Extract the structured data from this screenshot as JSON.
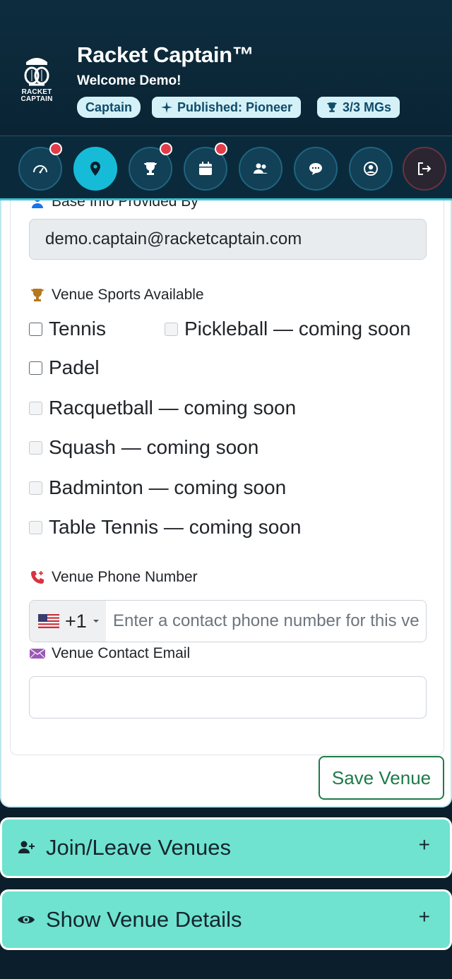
{
  "header": {
    "logo_text": "RACKET CAPTAIN",
    "app_title": "Racket Captain™",
    "welcome": "Welcome Demo!",
    "badges": [
      {
        "label": "Captain"
      },
      {
        "label": "Published: Pioneer"
      },
      {
        "label": "3/3 MGs"
      }
    ]
  },
  "nav": {
    "items": [
      {
        "icon": "dashboard-icon",
        "notification": true
      },
      {
        "icon": "location-pin-icon",
        "active": true,
        "notification": false
      },
      {
        "icon": "trophy-icon",
        "notification": true
      },
      {
        "icon": "calendar-icon",
        "notification": true
      },
      {
        "icon": "users-icon",
        "notification": false
      },
      {
        "icon": "chat-icon",
        "notification": false
      },
      {
        "icon": "user-circle-icon",
        "notification": false
      },
      {
        "icon": "logout-icon",
        "notification": false
      }
    ]
  },
  "form": {
    "base_info_label": "Base Info Provided By",
    "base_info_value": "demo.captain@racketcaptain.com",
    "sports_label": "Venue Sports Available",
    "sports": [
      {
        "label": "Tennis",
        "disabled": false
      },
      {
        "label": "Pickleball — coming soon",
        "disabled": true
      },
      {
        "label": "Padel",
        "disabled": false
      },
      {
        "label": "Racquetball — coming soon",
        "disabled": true
      },
      {
        "label": "Squash — coming soon",
        "disabled": true
      },
      {
        "label": "Badminton — coming soon",
        "disabled": true
      },
      {
        "label": "Table Tennis — coming soon",
        "disabled": true
      }
    ],
    "phone_label": "Venue Phone Number",
    "phone_country_code": "+1",
    "phone_placeholder": "Enter a contact phone number for this venue",
    "email_label": "Venue Contact Email",
    "email_value": "",
    "save_label": "Save Venue"
  },
  "accordions": [
    {
      "icon": "user-plus-icon",
      "title": "Join/Leave Venues",
      "toggle": "+"
    },
    {
      "icon": "eye-icon",
      "title": "Show Venue Details",
      "toggle": "+"
    }
  ],
  "colors": {
    "header_bg": "#0d2d3f",
    "nav_active": "#16bcd7",
    "badge_bg": "#d5f1f8",
    "accordion_bg": "#6fe3cf",
    "save_green": "#1e7a4a",
    "notification_red": "#e23b4a"
  }
}
